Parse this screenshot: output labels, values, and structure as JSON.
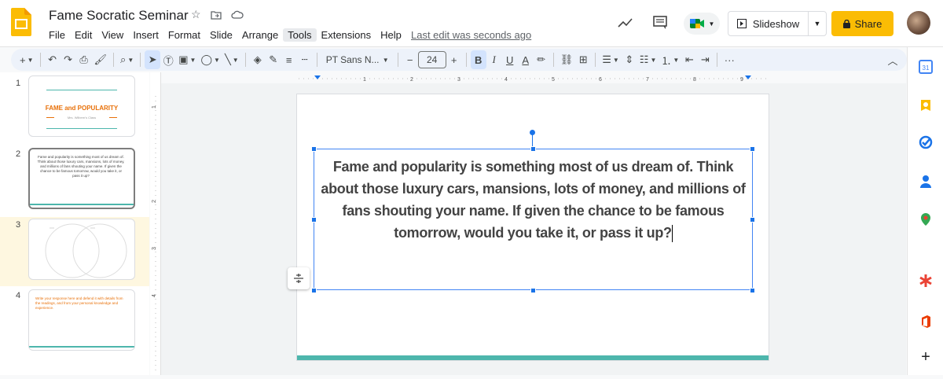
{
  "doc": {
    "title": "Fame Socratic Seminar",
    "last_edit": "Last edit was seconds ago"
  },
  "menu": [
    "File",
    "Edit",
    "View",
    "Insert",
    "Format",
    "Slide",
    "Arrange",
    "Tools",
    "Extensions",
    "Help"
  ],
  "header": {
    "slideshow_label": "Slideshow",
    "share_label": "Share"
  },
  "toolbar": {
    "font": "PT Sans N...",
    "font_size": "24",
    "bold": "B",
    "italic": "I",
    "underline": "U",
    "text_color": "A",
    "more": "···"
  },
  "filmstrip": {
    "slides": [
      {
        "number": "1",
        "title": "FAME and POPULARITY",
        "subtitle": "Mrs. Wilbern's Class"
      },
      {
        "number": "2",
        "body": "Fame and popularity is something most of us dream of. Think about those luxury cars, mansions, lots of money, and millions of fans shouting your name. If given the chance to be famous tomorrow, would you take it, or pass it up?"
      },
      {
        "number": "3"
      },
      {
        "number": "4",
        "body": "Write your response here and defend it with details from the readings, and from your personal knowledge and experience."
      }
    ]
  },
  "rulers": {
    "h_ticks": [
      "1",
      "2",
      "3",
      "4",
      "5",
      "6",
      "7",
      "8",
      "9"
    ],
    "v_ticks": [
      "1",
      "2",
      "3",
      "4"
    ]
  },
  "slide": {
    "text": "Fame and popularity is something most of us dream of. Think about those luxury cars, mansions, lots of money, and millions of fans shouting your name. If given the chance to be famous tomorrow, would you take it, or pass it up?"
  },
  "colors": {
    "share": "#fbbc04",
    "accent_teal": "#4db6ac",
    "selection": "#1a73e8",
    "title_orange": "#e8710a"
  }
}
